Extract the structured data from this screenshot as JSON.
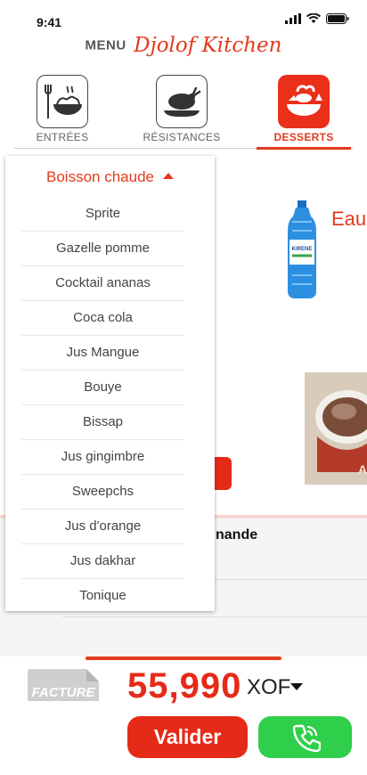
{
  "status_bar": {
    "time": "9:41"
  },
  "header": {
    "menu_word": "MENU",
    "brand": "Djolof Kitchen"
  },
  "tabs": [
    {
      "label": "ENTRÉES",
      "icon": "pasta-bowl-icon",
      "active": false
    },
    {
      "label": "RÉSISTANCES",
      "icon": "roast-chicken-icon",
      "active": false
    },
    {
      "label": "DESSERTS",
      "icon": "dessert-fruit-icon",
      "active": true
    }
  ],
  "background": {
    "product_name": "Eau",
    "bottle_brand": "KIRENE",
    "order_header_partial": "nande"
  },
  "dropdown": {
    "title": "Boisson chaude",
    "items": [
      "Sprite",
      "Gazelle pomme",
      "Cocktail ananas",
      "Coca cola",
      "Jus Mangue",
      "Bouye",
      "Bissap",
      "Jus gingimbre",
      "Sweepchs",
      "Jus d'orange",
      "Jus dakhar",
      "Tonique"
    ]
  },
  "bottom": {
    "facture_label": "FACTURE",
    "total": "55,990",
    "currency": "XOF",
    "validate_label": "Valider"
  },
  "colors": {
    "accent": "#e23a1d",
    "call": "#2fcf4b"
  }
}
